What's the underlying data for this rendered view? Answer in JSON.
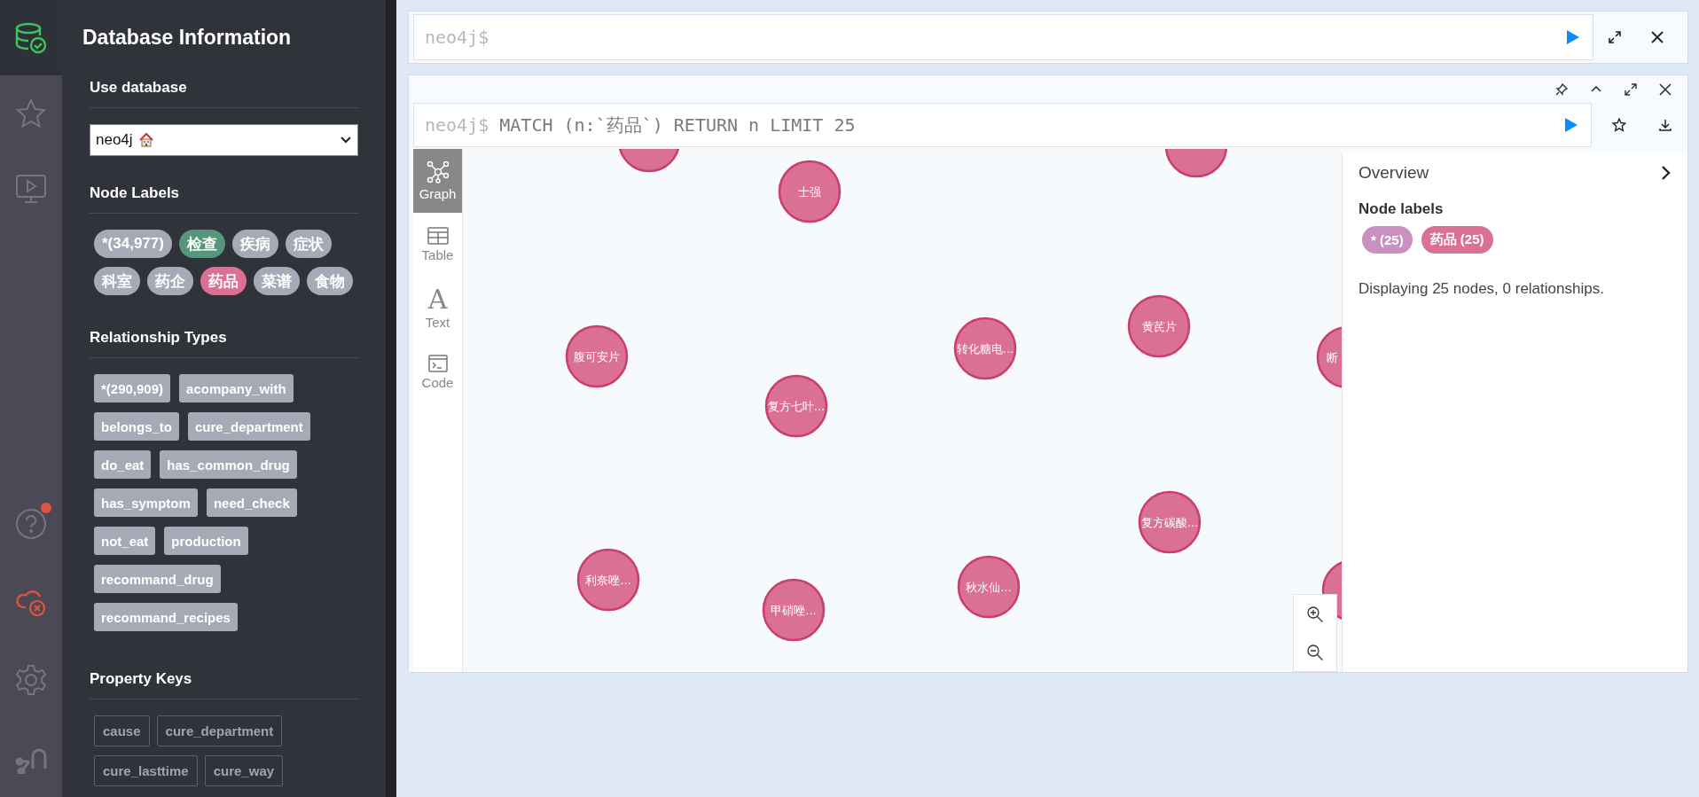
{
  "nav": [
    {
      "kind": "database",
      "selected": true,
      "alert": false
    },
    {
      "kind": "favorites",
      "selected": false,
      "alert": false
    },
    {
      "kind": "guides",
      "selected": false,
      "alert": false
    },
    {
      "kind": "help",
      "selected": false,
      "alert": true
    },
    {
      "kind": "connection",
      "selected": false,
      "alert": false
    },
    {
      "kind": "settings",
      "selected": false,
      "alert": false
    },
    {
      "kind": "about",
      "selected": false,
      "alert": false
    }
  ],
  "sidebar": {
    "title": "Database Information",
    "database": {
      "heading": "Use database",
      "value": "neo4j"
    },
    "node_labels": {
      "heading": "Node Labels",
      "items": [
        {
          "text": "*(34,977)",
          "color": "#a5abb6"
        },
        {
          "text": "检查",
          "color": "#57967c"
        },
        {
          "text": "疾病",
          "color": "#a5abb6"
        },
        {
          "text": "症状",
          "color": "#a5abb6"
        },
        {
          "text": "科室",
          "color": "#a5abb6"
        },
        {
          "text": "药企",
          "color": "#a5abb6"
        },
        {
          "text": "药品",
          "color": "#da7194"
        },
        {
          "text": "菜谱",
          "color": "#a5abb6"
        },
        {
          "text": "食物",
          "color": "#a5abb6"
        }
      ]
    },
    "relationship_types": {
      "heading": "Relationship Types",
      "items": [
        "*(290,909)",
        "acompany_with",
        "belongs_to",
        "cure_department",
        "do_eat",
        "has_common_drug",
        "has_symptom",
        "need_check",
        "not_eat",
        "production",
        "recommand_drug",
        "recommand_recipes"
      ]
    },
    "property_keys": {
      "heading": "Property Keys",
      "items": [
        "cause",
        "cure_department",
        "cure_lasttime",
        "cure_way"
      ]
    }
  },
  "editor": {
    "prompt": "neo4j$"
  },
  "result": {
    "prompt": "neo4j$",
    "query": "MATCH (n:`药品`) RETURN n LIMIT 25",
    "views": [
      {
        "kind": "graph",
        "label": "Graph",
        "selected": true
      },
      {
        "kind": "table",
        "label": "Table",
        "selected": false
      },
      {
        "kind": "text",
        "label": "Text",
        "glyph": "A",
        "selected": false
      },
      {
        "kind": "code",
        "label": "Code",
        "selected": false
      }
    ],
    "nodes": [
      {
        "kind": "partial"
      },
      {
        "kind": "node",
        "label": "士强"
      },
      {
        "kind": "partial"
      },
      {
        "kind": "node",
        "label": "腹可安片"
      },
      {
        "kind": "node",
        "label": "转化糖电…"
      },
      {
        "kind": "node",
        "label": "黄芪片"
      },
      {
        "kind": "node",
        "label": "断"
      },
      {
        "kind": "node",
        "label": "复方七叶…"
      },
      {
        "kind": "node",
        "label": "复方碳酸…"
      },
      {
        "kind": "node",
        "label": "利奈唑…"
      },
      {
        "kind": "node",
        "label": "甲硝唑…"
      },
      {
        "kind": "node",
        "label": "秋水仙…"
      },
      {
        "kind": "partial"
      }
    ],
    "overview": {
      "title": "Overview",
      "subtitle": "Node labels",
      "labels": [
        {
          "text": "* (25)",
          "color": "#c990c0"
        },
        {
          "text": "药品 (25)",
          "color": "#da7194"
        }
      ],
      "summary": "Displaying 25 nodes, 0 relationships."
    }
  }
}
